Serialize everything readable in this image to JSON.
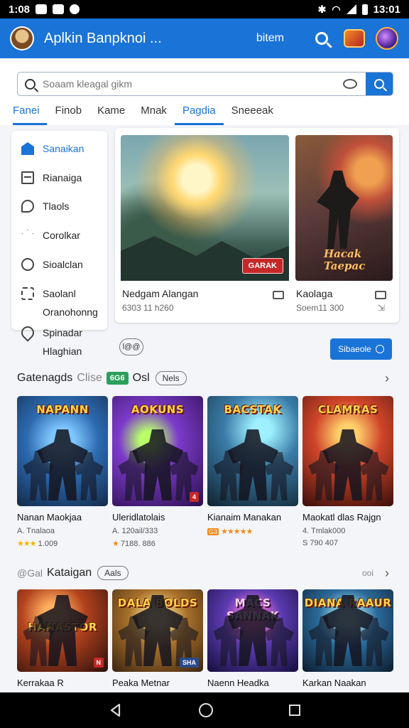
{
  "status_bar": {
    "time": "1:08",
    "clock_right": "13:01"
  },
  "app_bar": {
    "title": "Aplkin Banpknoi ...",
    "action_label": "bitem"
  },
  "search": {
    "placeholder": "Soaam kleagal gikm",
    "tabs": [
      "Fanei",
      "Finob",
      "Kame",
      "Mnak",
      "Pagdia",
      "Sneeeak"
    ],
    "active_tab": "Pagdia"
  },
  "sidebar": {
    "items": [
      {
        "label": "Sanaikan",
        "icon": "home-icon",
        "active": true
      },
      {
        "label": "Rianaiga",
        "icon": "box-icon"
      },
      {
        "label": "Tlaols",
        "icon": "tag-icon"
      },
      {
        "label": "Corolkar",
        "icon": "star-icon"
      },
      {
        "label": "Sioalclan",
        "icon": "chat-icon"
      },
      {
        "label": "Saolanl",
        "sub": "Oranohonng",
        "icon": "puzzle-icon"
      },
      {
        "label": "Spinadar",
        "sub": "Hlaghian",
        "icon": "pin-icon"
      }
    ]
  },
  "featured": [
    {
      "title": "Nedgam Alangan",
      "subtitle": "6303 11 h260",
      "badge": "GARAK"
    },
    {
      "title": "Kaolaga",
      "subtitle": "Soem11 300",
      "art_title": "Hacak Taepac"
    }
  ],
  "filter_pill": "l@@",
  "subscribe_label": "Sibaeole",
  "section1": {
    "title": "Gatenagds",
    "muted": "Clise",
    "green_badge": "6G6",
    "extra": "Osl",
    "pill": "Nels",
    "games": [
      {
        "art_title": "NAPANN",
        "name": "Nanan Maokjaa",
        "meta": "A. Tnalaoa",
        "stars": "★★★",
        "rating": "1.009"
      },
      {
        "art_title": "AOKUNS",
        "name": "Uleridlatolais",
        "meta": "A. 120ail/333",
        "stars": "★",
        "rating": "7188. 886",
        "corner": "4"
      },
      {
        "art_title": "BACSTAK",
        "name": "Kianaim Manakan",
        "meta": "",
        "stars": "★★★★★",
        "rating": "",
        "stars_orange": true,
        "meta_badge": "G3"
      },
      {
        "art_title": "CLAMRAS",
        "name": "Maokatl dlas Rajgn",
        "meta": "4. Tmlak000",
        "stars": "",
        "rating": "S 790 407"
      }
    ]
  },
  "section2": {
    "prefix": "@Gal",
    "title": "Kataigan",
    "pill": "Aals",
    "right_label": "ooi",
    "games": [
      {
        "art_title": "HANASTOR",
        "name": "Kerrakaa R",
        "corner": "N"
      },
      {
        "art_title": "DALA BOLDS",
        "name": "Peaka Metnar",
        "corner": "SHA"
      },
      {
        "art_title": "MACS SANNAK",
        "name": "Naenn Headka"
      },
      {
        "art_title": "DIANA RAAUR",
        "name": "Karkan Naakan"
      }
    ]
  }
}
